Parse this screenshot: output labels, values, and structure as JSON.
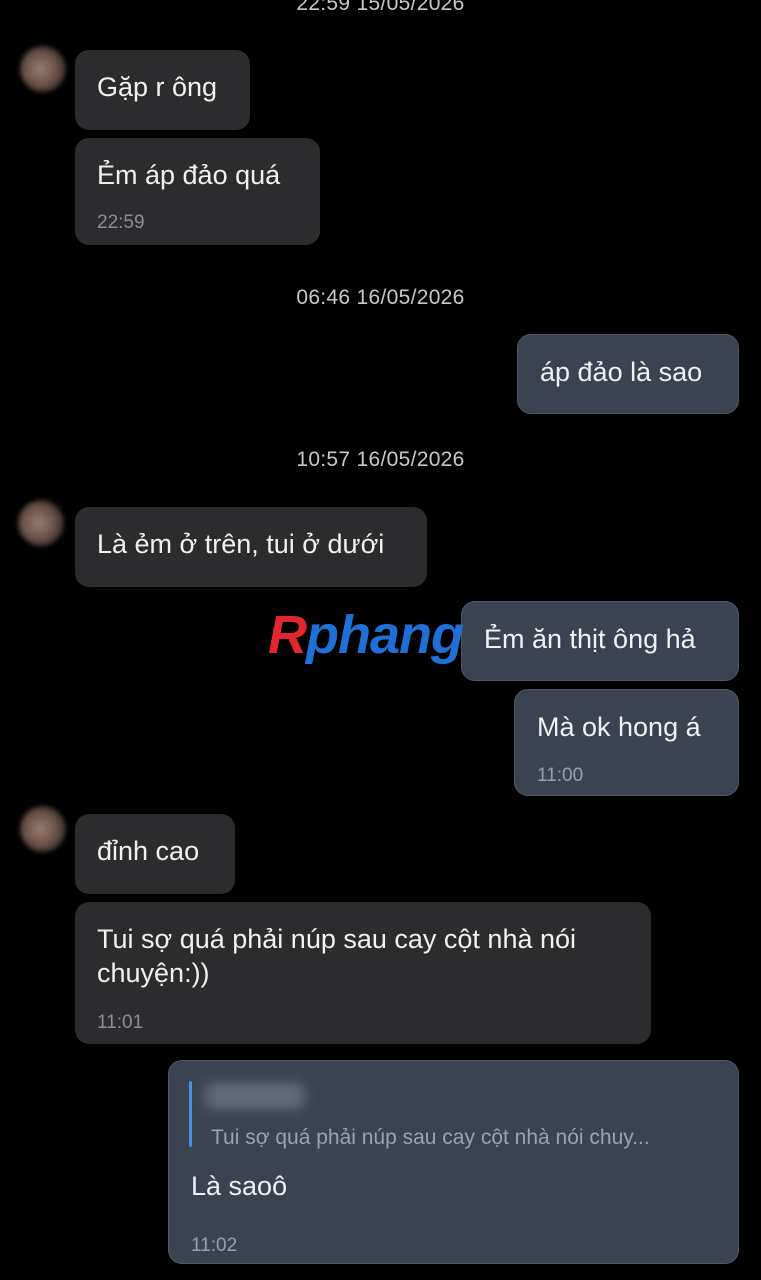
{
  "timestamps": {
    "top": "22:59 15/05/2026",
    "mid": "06:46 16/05/2026",
    "lower": "10:57 16/05/2026"
  },
  "messages": [
    {
      "side": "in",
      "text": "Gặp r ông"
    },
    {
      "side": "in",
      "text": "Ẻm áp đảo quá",
      "time": "22:59"
    },
    {
      "side": "out",
      "text": "áp đảo là sao"
    },
    {
      "side": "in",
      "text": "Là ẻm ở trên, tui ở dưới"
    },
    {
      "side": "out",
      "text": "Ẻm ăn thịt ông hả"
    },
    {
      "side": "out",
      "text": "Mà ok hong á",
      "time": "11:00"
    },
    {
      "side": "in",
      "text": "đỉnh cao"
    },
    {
      "side": "in",
      "text_line1": "Tui sợ quá phải núp sau cay cột nhà nói",
      "text_line2": "chuyện:))",
      "time": "11:01"
    },
    {
      "side": "out",
      "quote": "Tui sợ quá phải núp sau cay cột nhà nói chuy...",
      "text": "Là saoô",
      "time": "11:02"
    }
  ],
  "watermark": {
    "r": "R",
    "rest": "phang",
    "colors": {
      "r": "#e3262e",
      "rest": "#1f6fd6"
    }
  },
  "colors": {
    "background": "#000000",
    "incoming": "#2c2c2e",
    "outgoing": "#3a434f",
    "quote_bar": "#4a90e2"
  }
}
